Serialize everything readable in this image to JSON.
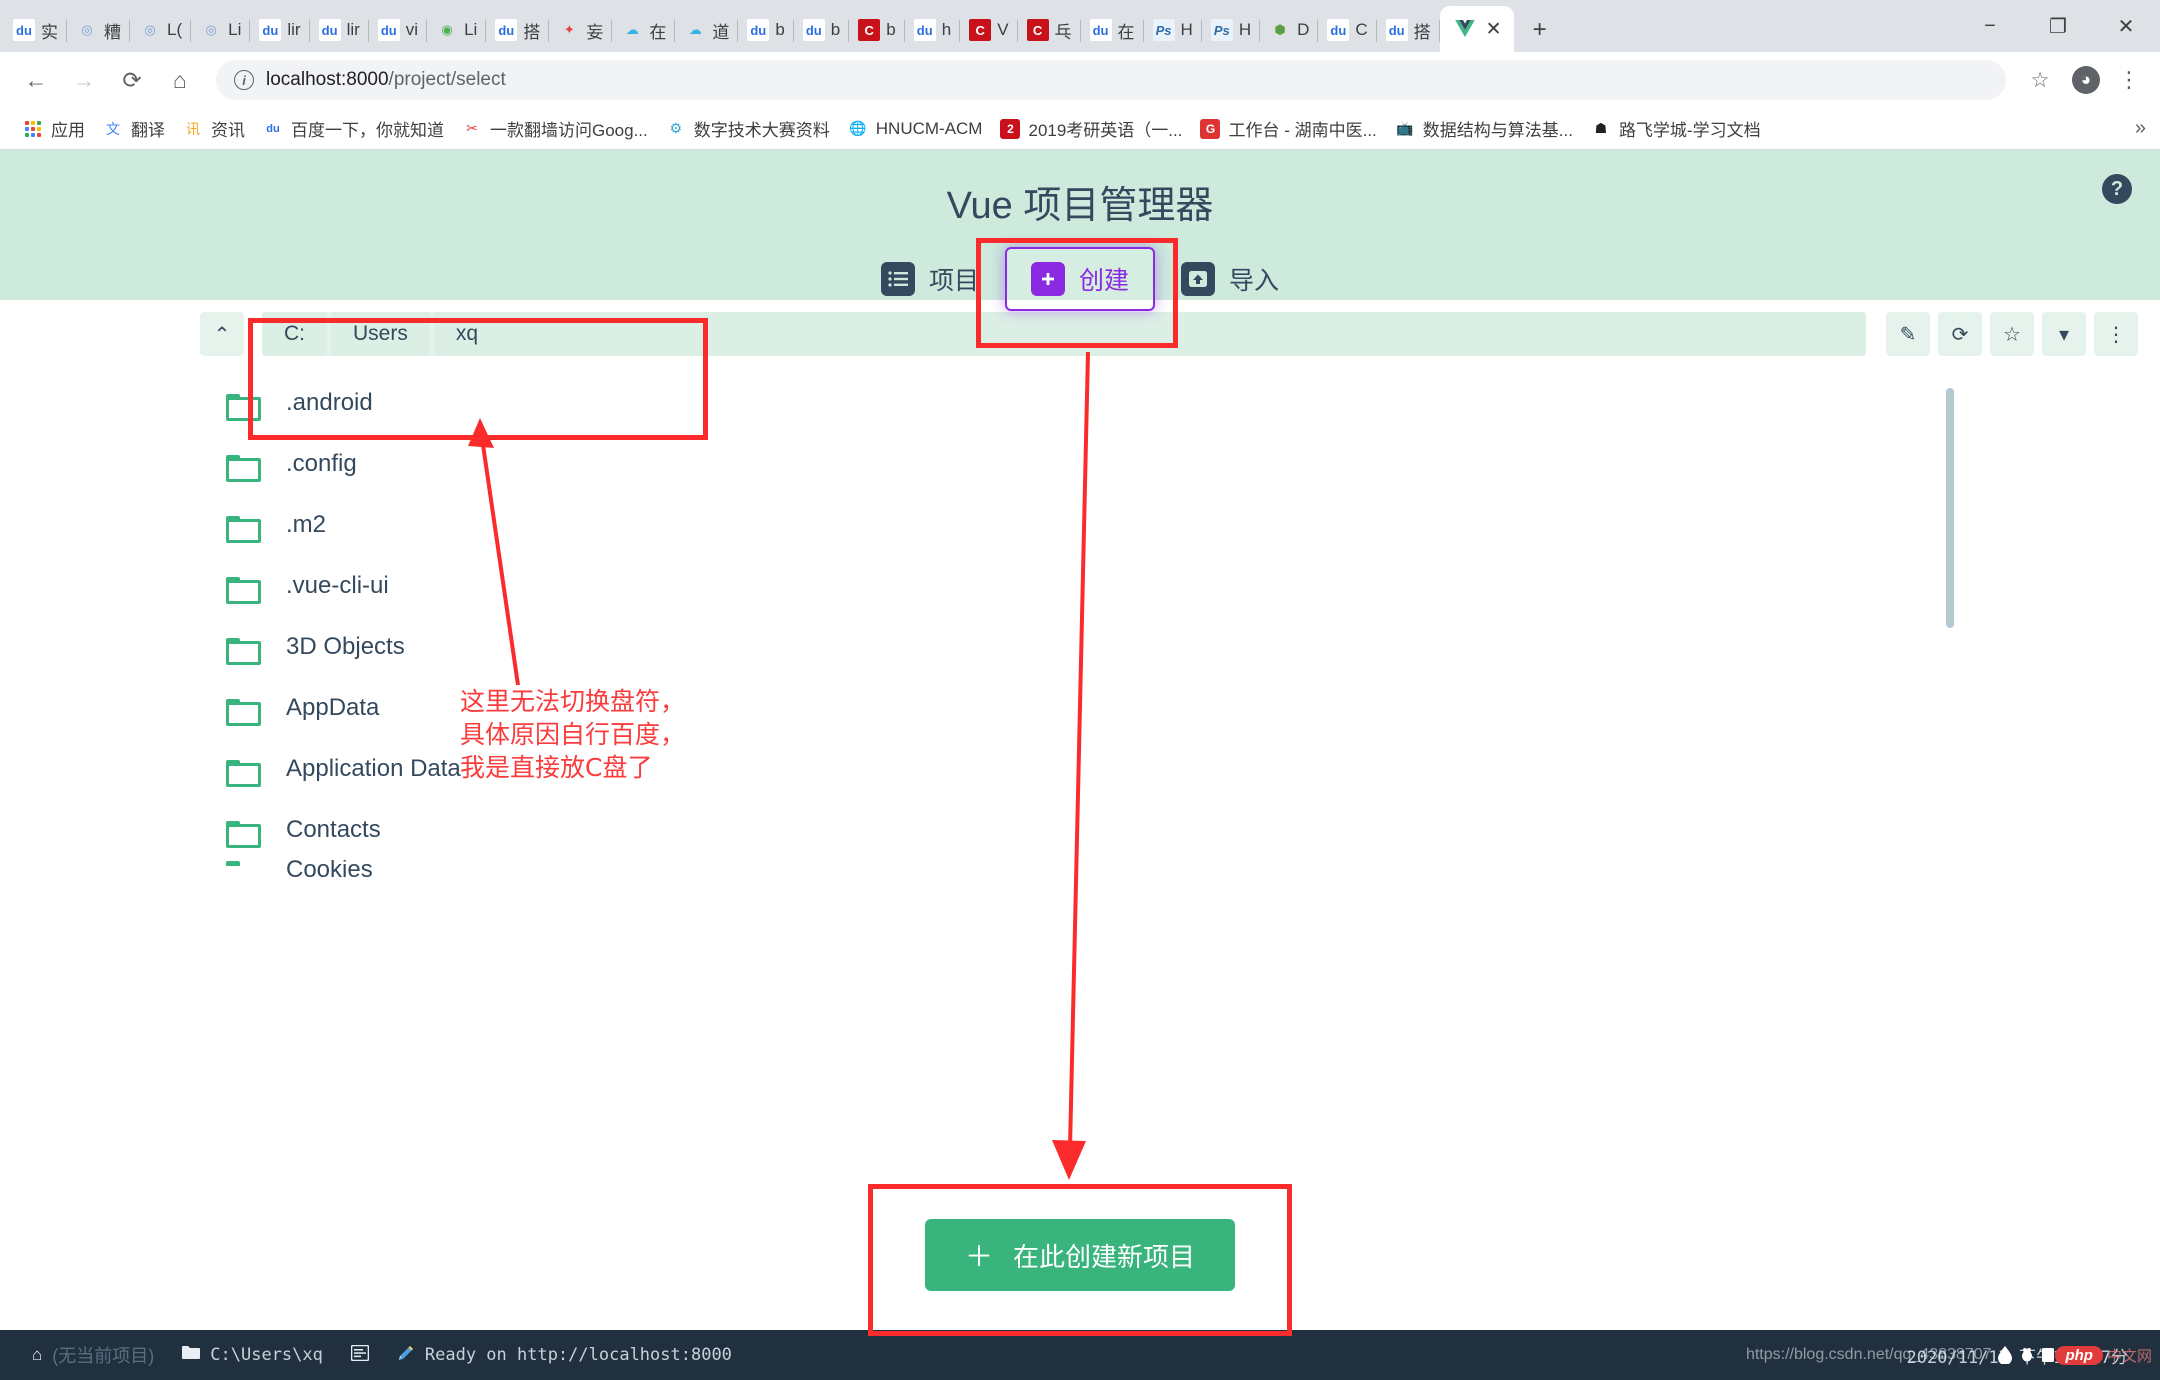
{
  "browser": {
    "tabs": [
      {
        "icon": "baidu-favicon",
        "label": "实"
      },
      {
        "icon": "weibo-favicon",
        "label": "糟"
      },
      {
        "icon": "weibo-favicon",
        "label": "L("
      },
      {
        "icon": "weibo-favicon",
        "label": "Li"
      },
      {
        "icon": "baidu-favicon",
        "label": "lir"
      },
      {
        "icon": "baidu-favicon",
        "label": "lir"
      },
      {
        "icon": "baidu-favicon",
        "label": "vi"
      },
      {
        "icon": "green-code-favicon",
        "label": "Li"
      },
      {
        "icon": "baidu-favicon",
        "label": "搭"
      },
      {
        "icon": "rocket-favicon",
        "label": "妄"
      },
      {
        "icon": "cloud-favicon",
        "label": "在"
      },
      {
        "icon": "cloud-favicon",
        "label": "道"
      },
      {
        "icon": "baidu-favicon",
        "label": "b"
      },
      {
        "icon": "baidu-favicon",
        "label": "b"
      },
      {
        "icon": "csdn-favicon",
        "label": "b"
      },
      {
        "icon": "baidu-favicon",
        "label": "h"
      },
      {
        "icon": "csdn-favicon",
        "label": "V"
      },
      {
        "icon": "csdn-favicon",
        "label": "乓"
      },
      {
        "icon": "baidu-favicon",
        "label": "在"
      },
      {
        "icon": "photoshop-favicon",
        "label": "H"
      },
      {
        "icon": "photoshop-favicon",
        "label": "H"
      },
      {
        "icon": "node-favicon",
        "label": "D"
      },
      {
        "icon": "baidu-favicon",
        "label": "C"
      },
      {
        "icon": "baidu-favicon",
        "label": "搭"
      }
    ],
    "active_tab": {
      "icon": "vue-favicon",
      "label": "",
      "close": "✕"
    },
    "new_tab_label": "+",
    "window_controls": {
      "minimize": "−",
      "maximize": "❐",
      "close": "✕"
    },
    "toolbar": {
      "back": "←",
      "forward": "→",
      "reload": "⟳",
      "home": "⌂",
      "url_secure_icon": "i",
      "url_host": "localhost:8000",
      "url_path": "/project/select",
      "bookmark_star": "☆",
      "profile": "◕",
      "menu": "⋮"
    },
    "bookmarks": [
      {
        "icon": "apps-grid-icon",
        "label": "应用"
      },
      {
        "icon": "google-translate-icon",
        "label": "翻译"
      },
      {
        "icon": "news-icon",
        "label": "资讯"
      },
      {
        "icon": "baidu-icon",
        "label": "百度一下，你就知道"
      },
      {
        "icon": "vpn-icon",
        "label": "一款翻墙访问Goog..."
      },
      {
        "icon": "gear-blue-icon",
        "label": "数字技术大赛资料"
      },
      {
        "icon": "globe-icon",
        "label": "HNUCM-ACM"
      },
      {
        "icon": "red-book-icon",
        "label": "2019考研英语（一..."
      },
      {
        "icon": "g-red-icon",
        "label": "工作台 - 湖南中医..."
      },
      {
        "icon": "bilibili-icon",
        "label": "数据结构与算法基..."
      },
      {
        "icon": "luffy-icon",
        "label": "路飞学城-学习文档"
      }
    ],
    "bookmarks_overflow": "»"
  },
  "app": {
    "title": "Vue 项目管理器",
    "help_icon_label": "?",
    "tabs": [
      {
        "icon": "list-icon",
        "label": "项目",
        "selected": false
      },
      {
        "icon": "plus-square-icon",
        "label": "创建",
        "selected": true
      },
      {
        "icon": "import-icon",
        "label": "导入",
        "selected": false
      }
    ],
    "pathbar": {
      "collapse_icon": "⌃",
      "crumbs": [
        "C:",
        "Users",
        "xq"
      ],
      "edit_icon": "✎",
      "refresh_icon": "⟳",
      "favorite_icon": "☆",
      "dropdown_icon": "▾",
      "more_icon": "⋮"
    },
    "folders": [
      ".android",
      ".config",
      ".m2",
      ".vue-cli-ui",
      "3D Objects",
      "AppData",
      "Application Data",
      "Contacts",
      "Cookies"
    ],
    "create_button": {
      "plus": "＋",
      "label": "在此创建新项目"
    }
  },
  "statusbar": {
    "home_icon": "⌂",
    "project_label": "(无当前项目)",
    "folder_icon": "📁",
    "path": "C:\\Users\\xq",
    "terminal_icon": "▤",
    "pencil_icon": "✏",
    "ready_text": "Ready on http://localhost:8000",
    "datetime": "2020/11/17  下午12时07分"
  },
  "annotations": {
    "note_lines": [
      "这里无法切换盘符，",
      "具体原因自行百度，",
      "我是直接放C盘了"
    ],
    "highlight_color": "#fb2b2b"
  },
  "watermark": {
    "url": "https://blog.csdn.net/qq_43838707",
    "badge": "php",
    "site": "中文网"
  }
}
